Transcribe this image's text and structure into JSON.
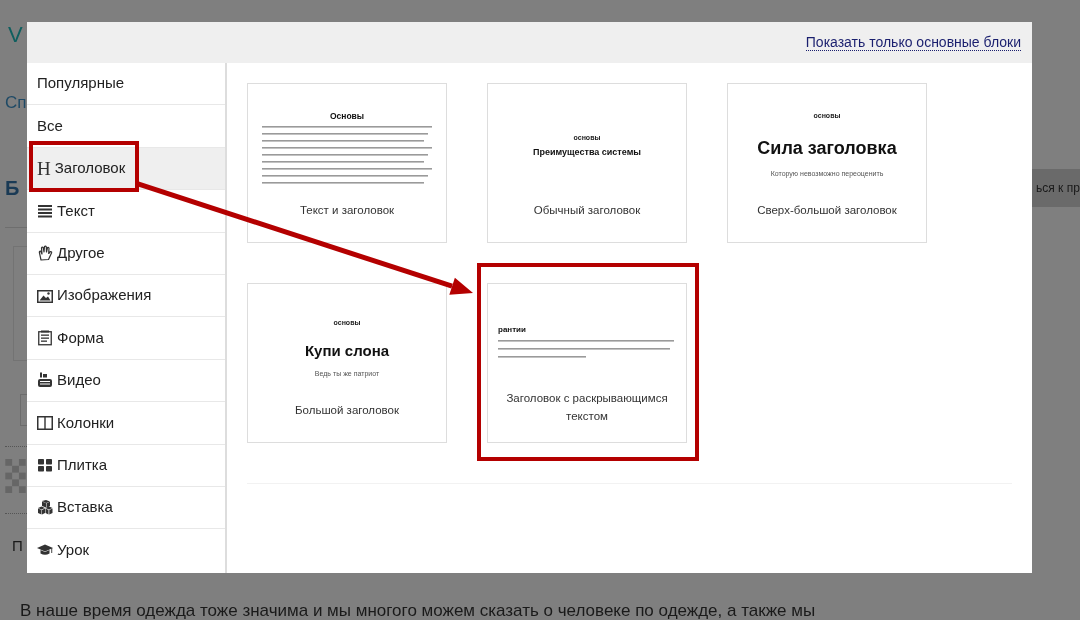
{
  "background_page": {
    "logo": "V",
    "breadcrumb": "Сп",
    "heading": "Б",
    "action_button": "ься к пр",
    "paragraph_start": "П",
    "paragraph": "В наше время одежда тоже значима и мы многого можем сказать о человеке по одежде, а также мы"
  },
  "modal": {
    "header_link": "Показать только основные блоки",
    "categories": [
      {
        "label": "Популярные",
        "selected": false,
        "highlighted": false
      },
      {
        "label": "Все",
        "selected": false,
        "highlighted": false
      },
      {
        "label": "Заголовок",
        "kind": "glyph",
        "glyph": "H",
        "selected": true,
        "highlighted": true
      },
      {
        "label": "Текст",
        "kind": "lines",
        "selected": false,
        "highlighted": false
      },
      {
        "label": "Другое",
        "kind": "hand",
        "selected": false,
        "highlighted": false
      },
      {
        "label": "Изображения",
        "kind": "image",
        "selected": false,
        "highlighted": false
      },
      {
        "label": "Форма",
        "kind": "form",
        "selected": false,
        "highlighted": false
      },
      {
        "label": "Видео",
        "kind": "video",
        "selected": false,
        "highlighted": false
      },
      {
        "label": "Колонки",
        "kind": "columns",
        "selected": false,
        "highlighted": false
      },
      {
        "label": "Плитка",
        "kind": "tiles",
        "selected": false,
        "highlighted": false
      },
      {
        "label": "Вставка",
        "kind": "cubes",
        "selected": false,
        "highlighted": false
      },
      {
        "label": "Урок",
        "kind": "cap",
        "selected": false,
        "highlighted": false
      }
    ],
    "blocks": [
      {
        "kind": "text",
        "heading": "Основы",
        "label": "Текст и заголовок",
        "highlighted": false
      },
      {
        "kind": "normal",
        "kicker": "основы",
        "heading": "Преимущества системы",
        "label": "Обычный заголовок",
        "highlighted": false
      },
      {
        "kind": "huge",
        "kicker": "основы",
        "heading": "Сила заголовка",
        "subtitle": "Которую невозможно переоценить",
        "label": "Сверх-большой заголовок",
        "highlighted": false
      },
      {
        "kind": "large",
        "kicker": "основы",
        "heading": "Купи слона",
        "subtitle": "Ведь ты же патриот",
        "label": "Большой заголовок",
        "highlighted": false
      },
      {
        "kind": "reveal",
        "heading": "рантии",
        "label": "Заголовок с раскрывающимся текстом",
        "highlighted": true
      }
    ]
  }
}
